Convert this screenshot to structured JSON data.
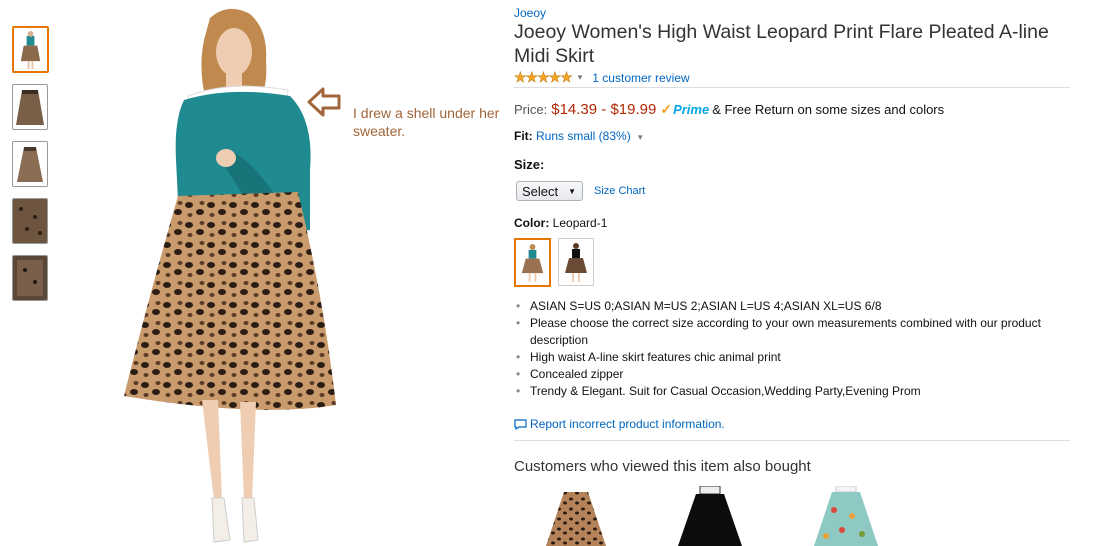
{
  "thumbnails": [
    {
      "name": "thumb-model-front",
      "selected": true
    },
    {
      "name": "thumb-skirt-1",
      "selected": false
    },
    {
      "name": "thumb-skirt-2",
      "selected": false
    },
    {
      "name": "thumb-skirt-3",
      "selected": false
    },
    {
      "name": "thumb-skirt-4",
      "selected": false
    }
  ],
  "annotation": {
    "text": "I drew a shell under her sweater.",
    "arrow_icon": "left-arrow-icon",
    "color": "#a0653a"
  },
  "product": {
    "brand": "Joeoy",
    "title": "Joeoy Women's High Waist Leopard Print Flare Pleated A-line Midi Skirt",
    "stars": "★★★★★",
    "rating_caret": "▾",
    "review_count": "1 customer review",
    "price_label": "Price:",
    "price": "$14.39 - $19.99",
    "prime_check": "✓",
    "prime_text": "Prime",
    "shipping_text": "& Free Return on some sizes and colors",
    "fit_label": "Fit:",
    "fit_value": "Runs small (83%)",
    "fit_caret": "▾",
    "size_label": "Size:",
    "size_select": "Select",
    "size_select_caret": "▼",
    "size_chart": "Size Chart",
    "color_label": "Color:",
    "color_value": "Leopard-1",
    "bullets": [
      "ASIAN S=US 0;ASIAN M=US 2;ASIAN L=US 4;ASIAN XL=US 6/8",
      "Please choose the correct size according to your own measurements combined with our product description",
      "High waist A-line skirt features chic animal print",
      "Concealed zipper",
      "Trendy & Elegant. Suit for Casual Occasion,Wedding Party,Evening Prom"
    ],
    "report_icon": "comment-icon",
    "report_text": "Report incorrect product information."
  },
  "also_bought": {
    "heading": "Customers who viewed this item also bought",
    "items": [
      {
        "name": "leopard-skirt"
      },
      {
        "name": "black-skirt"
      },
      {
        "name": "floral-skirt"
      }
    ]
  },
  "colors": {
    "link": "#0066c0",
    "price": "#b12704",
    "selected": "#e77600",
    "prime": "#00a8e1",
    "star": "#f5a623"
  }
}
